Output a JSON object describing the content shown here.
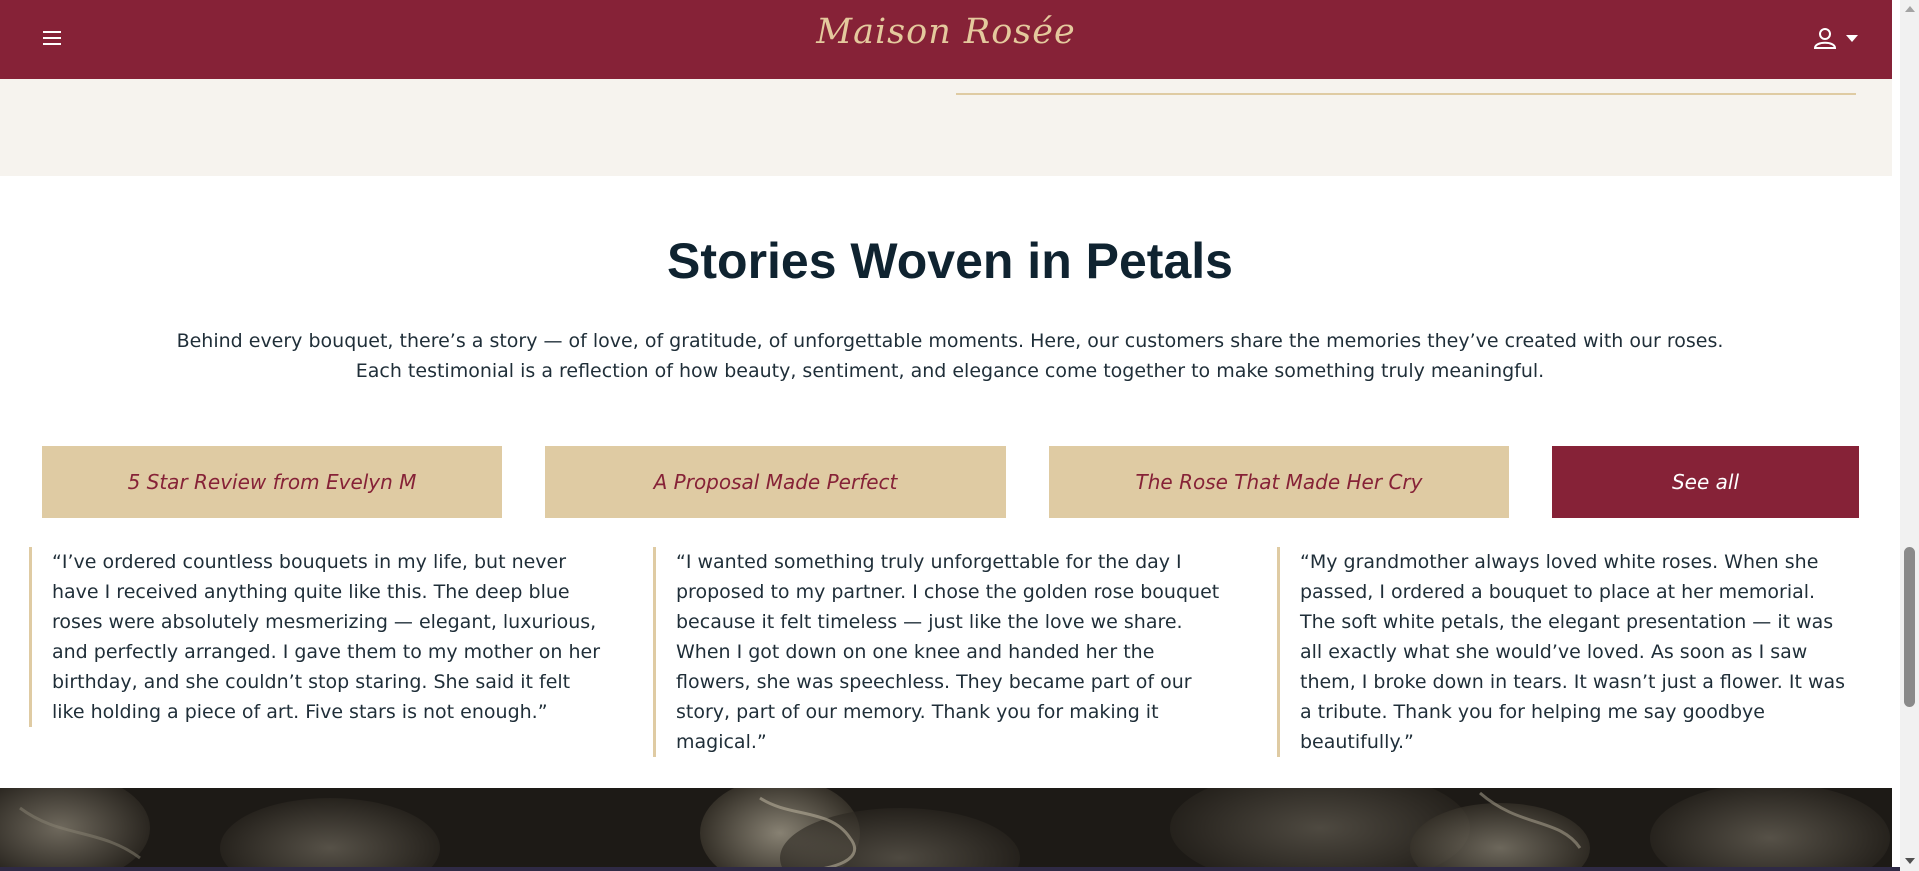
{
  "header": {
    "brand": "Maison Rosée",
    "menu_icon": "hamburger-menu-icon",
    "account_icon": "user-icon",
    "account_caret_icon": "caret-down-icon"
  },
  "stories": {
    "title": "Stories Woven in Petals",
    "intro": "Behind every bouquet, there’s a story — of love, of gratitude, of unforgettable moments. Here, our customers share the memories they’ve created with our roses. Each testimonial is a reflection of how beauty, sentiment, and elegance come together to make something truly meaningful.",
    "tabs": [
      {
        "label": "5 Star Review from Evelyn M"
      },
      {
        "label": "A Proposal Made Perfect"
      },
      {
        "label": "The Rose That Made Her Cry"
      },
      {
        "label": "See all"
      }
    ],
    "testimonials": [
      {
        "text": "“I’ve ordered countless bouquets in my life, but never have I received anything quite like this. The deep blue roses were absolutely mesmerizing — elegant, luxurious, and perfectly arranged. I gave them to my mother on her birthday, and she couldn’t stop staring. She said it felt like holding a piece of art. Five stars is not enough.”"
      },
      {
        "text": "“I wanted something truly unforgettable for the day I proposed to my partner. I chose the golden rose bouquet because it felt timeless — just like the love we share. When I got down on one knee and handed her the flowers, she was speechless. They became part of our story, part of our memory. Thank you for making it magical.”"
      },
      {
        "text": "“My grandmother always loved white roses. When she passed, I ordered a bouquet to place at her memorial. The soft white petals, the elegant presentation — it was all exactly what she would’ve loved. As soon as I saw them, I broke down in tears. It wasn’t just a flower. It was a tribute. Thank you for helping me say goodbye beautifully.”"
      }
    ]
  },
  "colors": {
    "brand_burgundy": "#862237",
    "gold": "#e4c99d",
    "tan": "#dfcba3",
    "cream": "#f6f3ee",
    "text_dark": "#0f2330"
  }
}
